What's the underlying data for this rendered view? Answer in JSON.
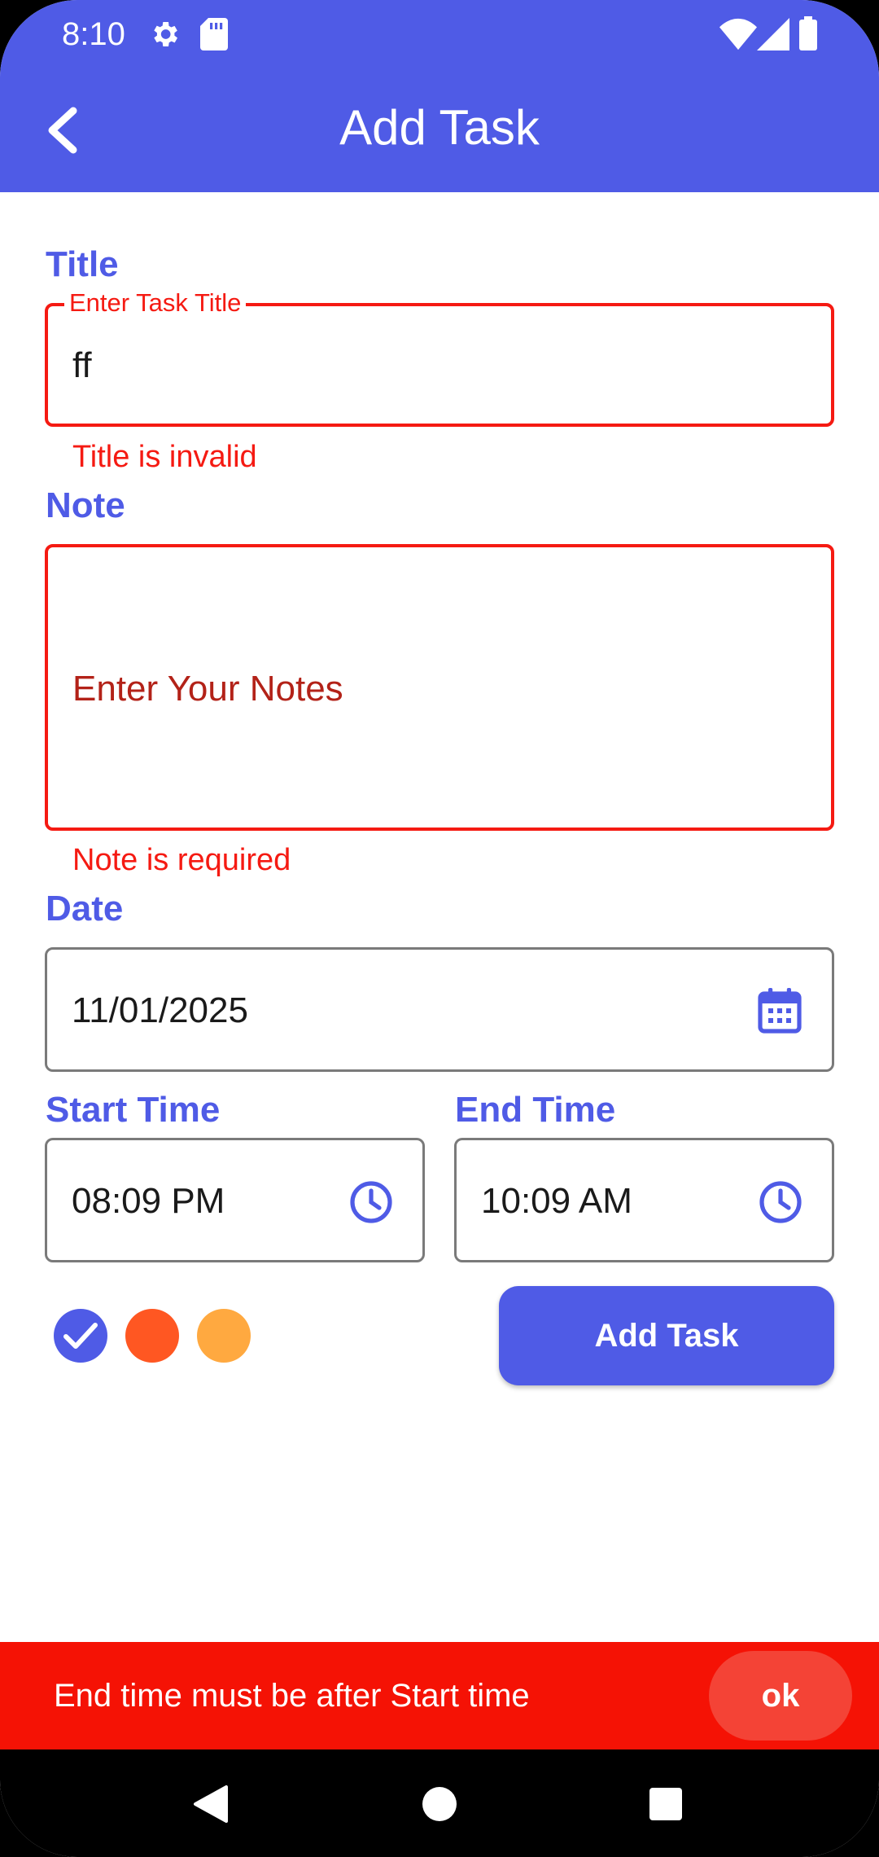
{
  "status_bar": {
    "time": "8:10"
  },
  "app_bar": {
    "title": "Add Task"
  },
  "form": {
    "title": {
      "label": "Title",
      "floating_label": "Enter Task Title",
      "value": "ff",
      "error": "Title is invalid"
    },
    "note": {
      "label": "Note",
      "placeholder": "Enter Your Notes",
      "error": "Note is required"
    },
    "date": {
      "label": "Date",
      "value": "11/01/2025"
    },
    "start_time": {
      "label": "Start Time",
      "value": "08:09 PM"
    },
    "end_time": {
      "label": "End Time",
      "value": "10:09 AM"
    },
    "colors": {
      "options": [
        "#4F5BE6",
        "#FF5722",
        "#FFA940"
      ],
      "selected_index": 0
    },
    "submit_label": "Add Task"
  },
  "snackbar": {
    "message": "End time must be after Start time",
    "action": "ok"
  },
  "theme": {
    "primary": "#4F5BE6",
    "error": "#F51A12"
  }
}
